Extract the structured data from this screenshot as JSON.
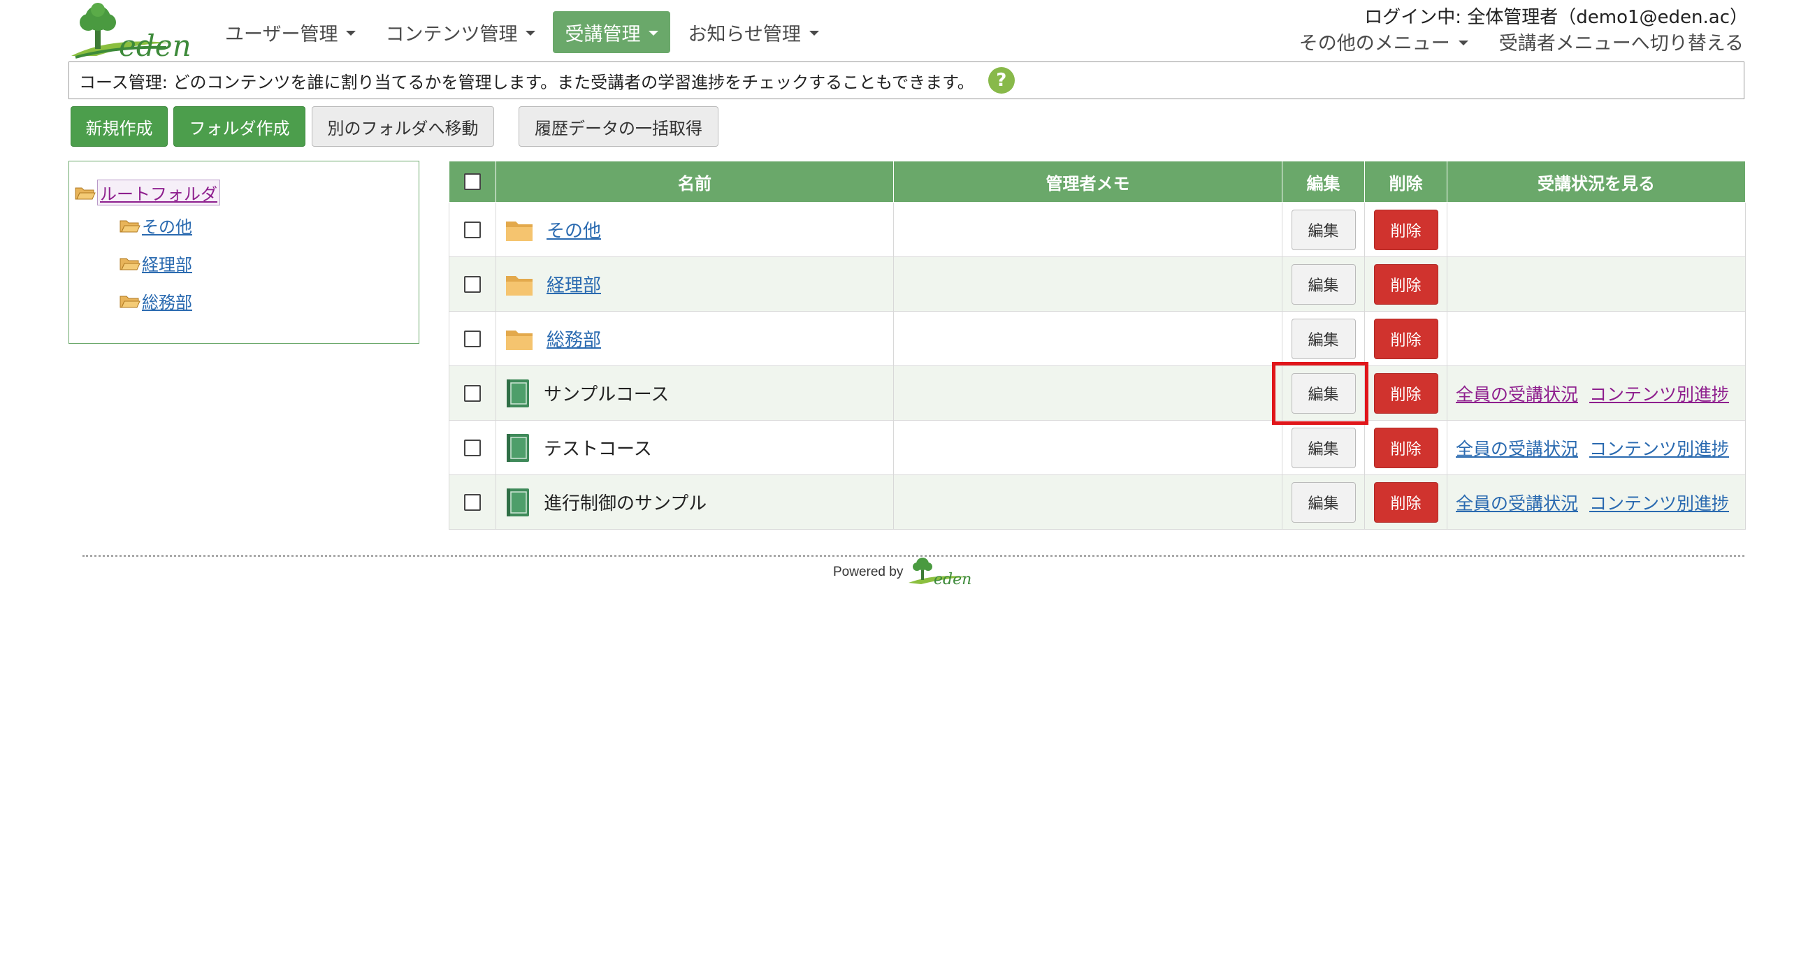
{
  "brand": {
    "logo_text": "eden",
    "primary_color": "#6aa86a",
    "danger_color": "#d0332e"
  },
  "nav": {
    "items": [
      {
        "label": "ユーザー管理",
        "active": false
      },
      {
        "label": "コンテンツ管理",
        "active": false
      },
      {
        "label": "受講管理",
        "active": true
      },
      {
        "label": "お知らせ管理",
        "active": false
      }
    ]
  },
  "header": {
    "login_text": "ログイン中: 全体管理者（demo1@eden.ac）",
    "other_menu": "その他のメニュー",
    "switch_menu": "受講者メニューへ切り替える"
  },
  "notice": {
    "text": "コース管理: どのコンテンツを誰に割り当てるかを管理します。また受講者の学習進捗をチェックすることもできます。",
    "help_icon": "question-icon"
  },
  "toolbar": {
    "new_label": "新規作成",
    "new_folder_label": "フォルダ作成",
    "move_label": "別のフォルダへ移動",
    "bulk_history_label": "履歴データの一括取得"
  },
  "tree": {
    "root": "ルートフォルダ",
    "children": [
      "その他",
      "経理部",
      "総務部"
    ]
  },
  "table": {
    "headers": {
      "name": "名前",
      "memo": "管理者メモ",
      "edit": "編集",
      "delete": "削除",
      "status": "受講状況を見る"
    },
    "edit_label": "編集",
    "delete_label": "削除",
    "rows": [
      {
        "type": "folder",
        "name": "その他",
        "memo": ""
      },
      {
        "type": "folder",
        "name": "経理部",
        "memo": ""
      },
      {
        "type": "folder",
        "name": "総務部",
        "memo": ""
      },
      {
        "type": "course",
        "name": "サンプルコース",
        "memo": "",
        "link_all": "全員の受講状況",
        "link_content": "コンテンツ別進捗"
      },
      {
        "type": "course",
        "name": "テストコース",
        "memo": "",
        "link_all": "全員の受講状況",
        "link_content": "コンテンツ別進捗"
      },
      {
        "type": "course",
        "name": "進行制御のサンプル",
        "memo": "",
        "link_all": "全員の受講状況",
        "link_content": "コンテンツ別進捗"
      }
    ]
  },
  "footer": {
    "powered_by": "Powered by",
    "logo_text": "eden"
  }
}
